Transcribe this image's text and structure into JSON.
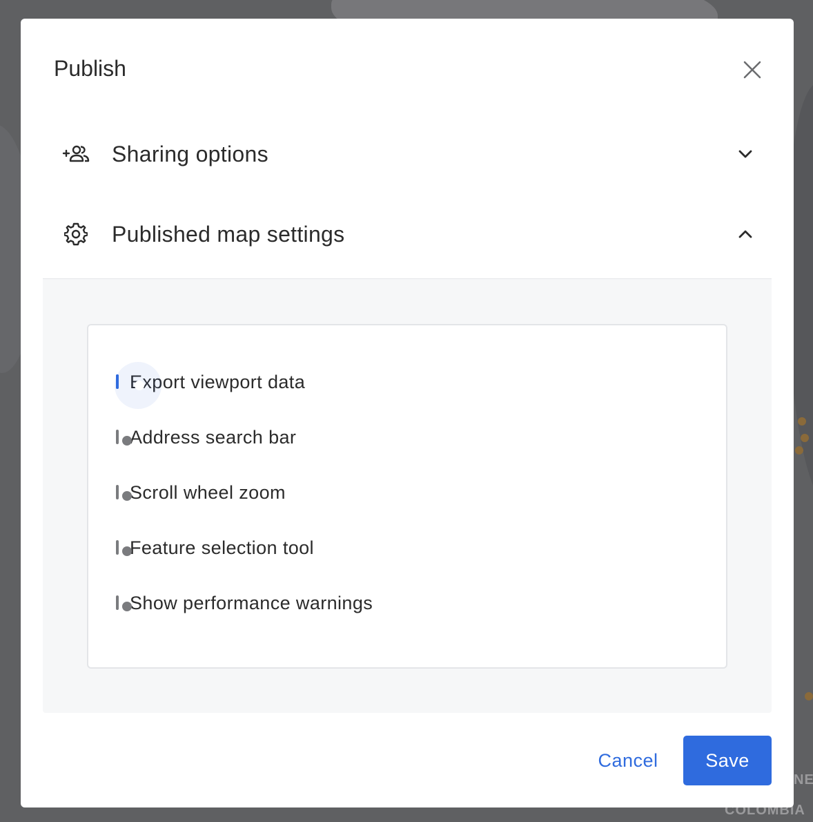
{
  "modal": {
    "title": "Publish",
    "close_icon": "close-icon"
  },
  "sections": {
    "sharing": {
      "label": "Sharing options",
      "icon": "add-people-icon",
      "expanded": false
    },
    "published_settings": {
      "label": "Published map settings",
      "icon": "gear-icon",
      "expanded": true
    }
  },
  "toggles": [
    {
      "label": "Export viewport data",
      "on": true
    },
    {
      "label": "Address search bar",
      "on": false
    },
    {
      "label": "Scroll wheel zoom",
      "on": false
    },
    {
      "label": "Feature selection tool",
      "on": false
    },
    {
      "label": "Show performance warnings",
      "on": false
    }
  ],
  "footer": {
    "cancel_label": "Cancel",
    "save_label": "Save"
  },
  "background_map": {
    "labels": [
      "COLOMBIA",
      "NE"
    ]
  },
  "colors": {
    "accent": "#2f6bde",
    "toggle_off": "#7a7b7e",
    "panel_bg": "#f6f7f8"
  }
}
